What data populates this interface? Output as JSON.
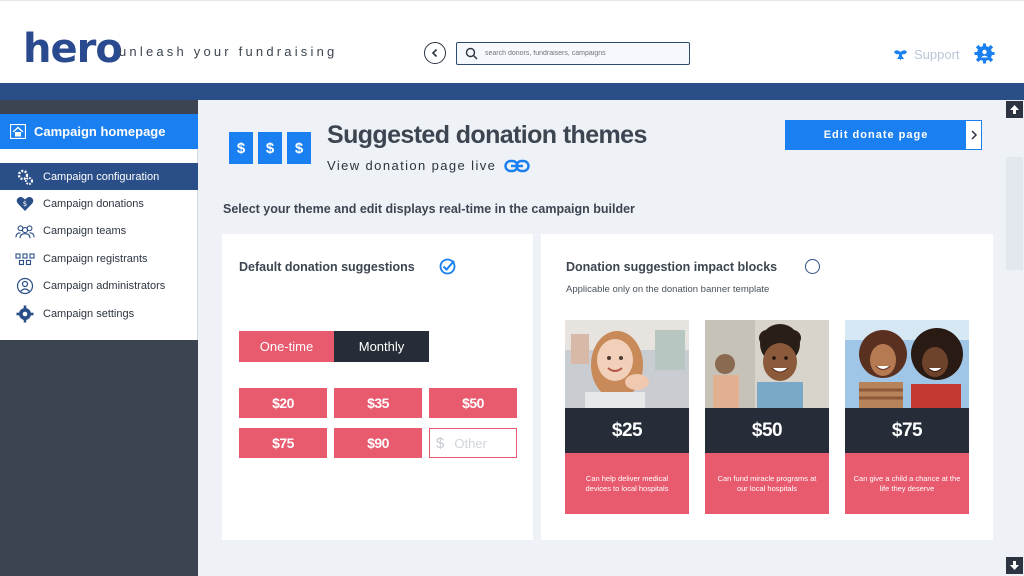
{
  "header": {
    "logo": "hero",
    "tagline": "unleash your fundraising",
    "search_placeholder": "search donors, fundraisers, campaigns",
    "support_label": "Support"
  },
  "sidebar": {
    "home_label": "Campaign homepage",
    "items": [
      {
        "label": "Campaign configuration",
        "icon": "gear-cluster-icon",
        "active": true
      },
      {
        "label": "Campaign donations",
        "icon": "heart-icon"
      },
      {
        "label": "Campaign teams",
        "icon": "team-icon"
      },
      {
        "label": "Campaign registrants",
        "icon": "registrants-icon"
      },
      {
        "label": "Campaign administrators",
        "icon": "admin-icon"
      },
      {
        "label": "Campaign settings",
        "icon": "settings-icon"
      }
    ]
  },
  "main": {
    "dollar_tiles": [
      "$",
      "$",
      "$"
    ],
    "title": "Suggested donation themes",
    "view_live": "View donation page live",
    "edit_button": "Edit donate page",
    "subtitle": "Select your theme and edit displays real-time in the campaign builder",
    "left_card": {
      "title": "Default donation suggestions",
      "selected": true,
      "toggle": [
        "One-time",
        "Monthly"
      ],
      "amounts": [
        "$20",
        "$35",
        "$50",
        "$75",
        "$90"
      ],
      "other_symbol": "$",
      "other_placeholder": "Other"
    },
    "right_card": {
      "title": "Donation suggestion impact blocks",
      "selected": false,
      "note": "Applicable only on the donation banner template",
      "blocks": [
        {
          "amount": "$25",
          "text": "Can help deliver medical devices to local hospitals"
        },
        {
          "amount": "$50",
          "text": "Can fund miracle programs at our local hospitals"
        },
        {
          "amount": "$75",
          "text": "Can give a child a chance at the life they deserve"
        }
      ]
    }
  },
  "colors": {
    "brand_blue": "#1a7ff0",
    "navy": "#2a4e87",
    "coral": "#e85a6e",
    "dark": "#262d38"
  }
}
